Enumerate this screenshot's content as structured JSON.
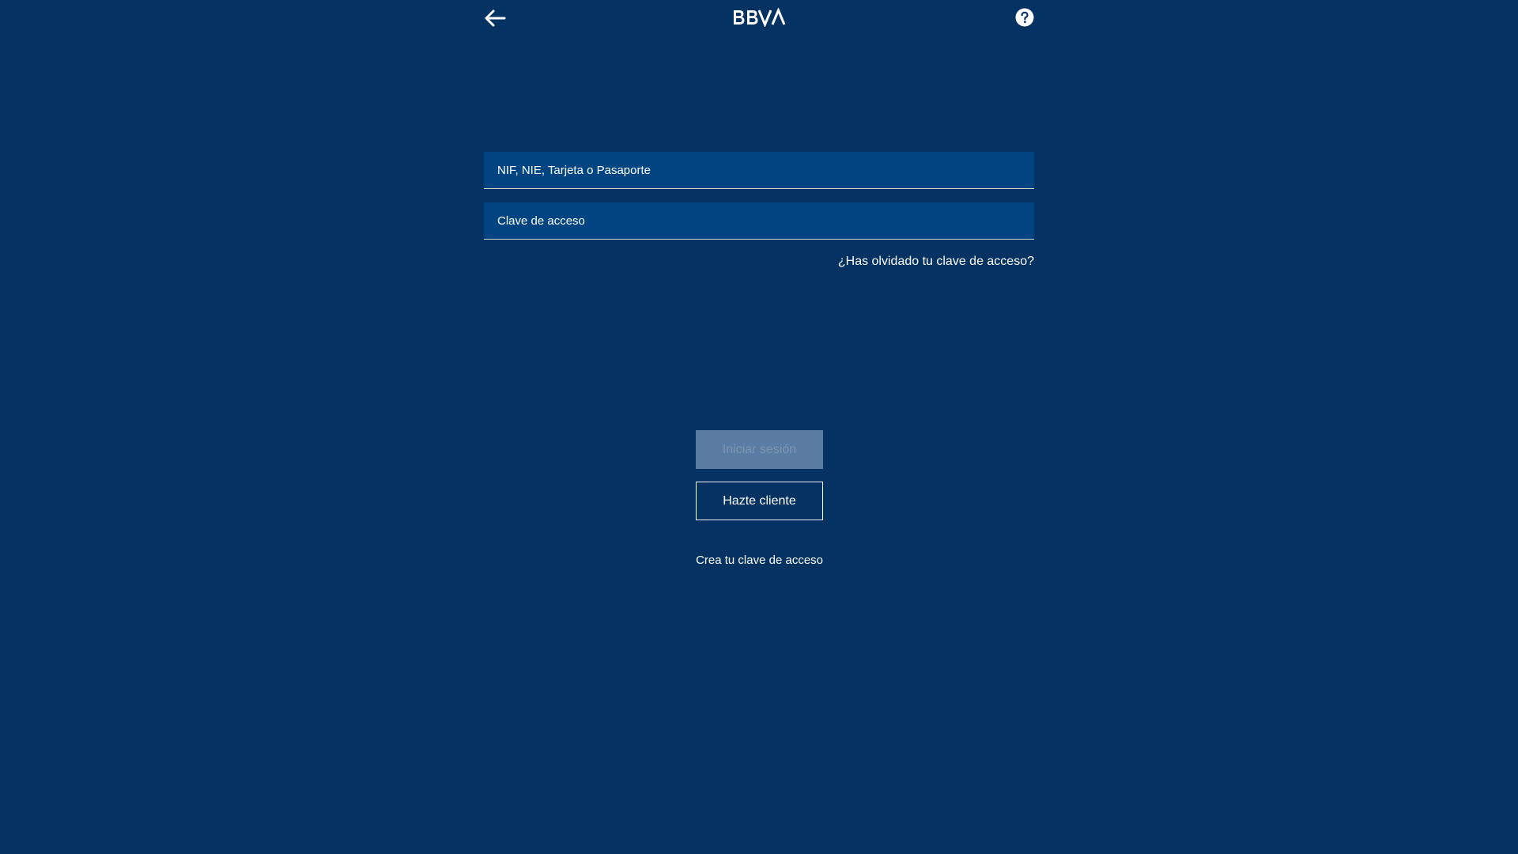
{
  "header": {
    "back_icon": "arrow-left-icon",
    "logo_text": "BBVA",
    "help_icon": "question-circle-icon"
  },
  "login_form": {
    "user_field": {
      "placeholder": "NIF, NIE, Tarjeta o Pasaporte",
      "value": ""
    },
    "password_field": {
      "placeholder": "Clave de acceso",
      "value": ""
    },
    "forgot_link": "¿Has olvidado tu clave de acceso?",
    "login_button": "Iniciar sesión",
    "signup_button": "Hazte cliente",
    "create_password_link": "Crea tu clave de acceso"
  },
  "colors": {
    "background": "#043263",
    "field_background": "#004481",
    "disabled_button": "#5b7ca3",
    "text": "#ffffff"
  }
}
